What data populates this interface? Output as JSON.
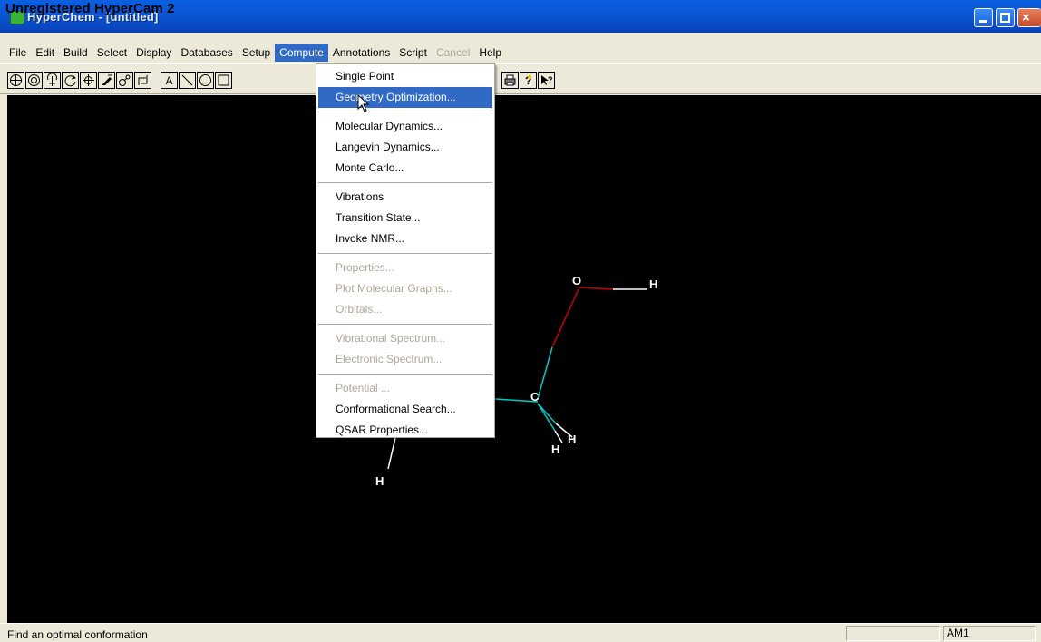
{
  "window": {
    "title": "HyperChem - [untitled]",
    "overlay_title": "Unregistered HyperCam 2",
    "controls": {
      "minimize": "minimize",
      "maximize": "maximize",
      "close": "×"
    }
  },
  "menubar": {
    "items": [
      "File",
      "Edit",
      "Build",
      "Select",
      "Display",
      "Databases",
      "Setup",
      "Compute",
      "Annotations",
      "Script",
      "Cancel",
      "Help"
    ],
    "active": "Compute",
    "disabled": [
      "Cancel"
    ]
  },
  "toolbar": {
    "text_tool": "A",
    "icons": [
      "draw-tool-icon",
      "select-tool-icon",
      "rotate-out-of-plane-icon",
      "rotate-in-plane-icon",
      "translate-icon",
      "z-translate-icon",
      "zoom-icon",
      "z-clip-icon",
      "text-annotation-icon",
      "line-annotation-icon",
      "ellipse-annotation-icon",
      "rectangle-annotation-icon",
      "print-icon",
      "help-icon",
      "context-help-icon"
    ]
  },
  "compute_menu": {
    "groups": [
      [
        {
          "label": "Single Point",
          "enabled": true
        },
        {
          "label": "Geometry Optimization...",
          "enabled": true,
          "highlighted": true
        }
      ],
      [
        {
          "label": "Molecular Dynamics...",
          "enabled": true
        },
        {
          "label": "Langevin Dynamics...",
          "enabled": true
        },
        {
          "label": "Monte Carlo...",
          "enabled": true
        }
      ],
      [
        {
          "label": "Vibrations",
          "enabled": true
        },
        {
          "label": "Transition State...",
          "enabled": true
        },
        {
          "label": "Invoke NMR...",
          "enabled": true
        }
      ],
      [
        {
          "label": "Properties...",
          "enabled": false
        },
        {
          "label": "Plot Molecular Graphs...",
          "enabled": false
        },
        {
          "label": "Orbitals...",
          "enabled": false
        }
      ],
      [
        {
          "label": "Vibrational Spectrum...",
          "enabled": false
        },
        {
          "label": "Electronic Spectrum...",
          "enabled": false
        }
      ],
      [
        {
          "label": "Potential ...",
          "enabled": false
        },
        {
          "label": "Conformational Search...",
          "enabled": true
        },
        {
          "label": "QSAR Properties...",
          "enabled": true
        }
      ]
    ]
  },
  "molecule": {
    "atoms": {
      "o": "O",
      "h1": "H",
      "c": "C",
      "h2": "H",
      "h3": "H",
      "h4": "H"
    },
    "colors": {
      "oxygen_bond": "#c80000",
      "carbon_bond": "#00c8c8",
      "hydrogen_bond": "#ffffff"
    }
  },
  "statusbar": {
    "message": "Find an optimal conformation",
    "method": "AM1"
  }
}
